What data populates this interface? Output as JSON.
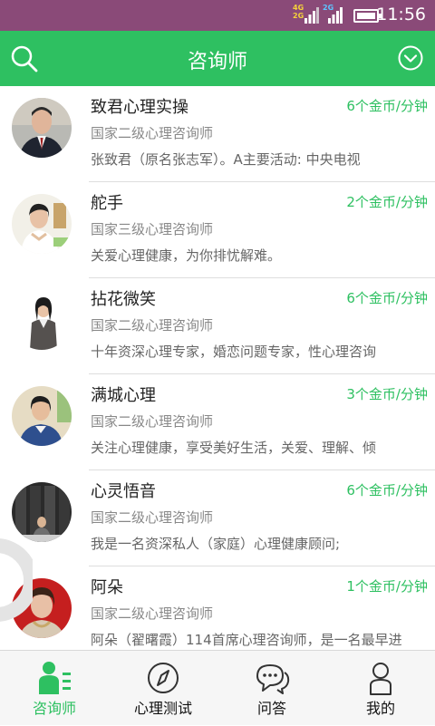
{
  "status_bar": {
    "network_a_top": "4G",
    "network_a_bottom": "2G",
    "network_b": "2G",
    "time": "11:56"
  },
  "app_bar": {
    "title": "咨询师",
    "search_icon": "search-icon",
    "dropdown_icon": "chevron-down-circle-icon"
  },
  "counselors": [
    {
      "name": "致君心理实操",
      "price": "6个金币/分钟",
      "level": "国家二级心理咨询师",
      "description": "张致君（原名张志军）。A主要活动: 中央电视"
    },
    {
      "name": "舵手",
      "price": "2个金币/分钟",
      "level": "国家三级心理咨询师",
      "description": "关爱心理健康，为你排忧解难。"
    },
    {
      "name": "拈花微笑",
      "price": "6个金币/分钟",
      "level": "国家二级心理咨询师",
      "description": "十年资深心理专家，婚恋问题专家，性心理咨询"
    },
    {
      "name": "满城心理",
      "price": "3个金币/分钟",
      "level": "国家二级心理咨询师",
      "description": "关注心理健康，享受美好生活，关爱、理解、倾"
    },
    {
      "name": "心灵悟音",
      "price": "6个金币/分钟",
      "level": "国家二级心理咨询师",
      "description": "我是一名资深私人（家庭）心理健康顾问;"
    },
    {
      "name": "阿朵",
      "price": "1个金币/分钟",
      "level": "国家二级心理咨询师",
      "description": "阿朵（翟曙霞）114首席心理咨询师，是一名最早进"
    }
  ],
  "tab_bar": {
    "tabs": [
      {
        "label": "咨询师",
        "icon": "counselor-icon",
        "active": true
      },
      {
        "label": "心理测试",
        "icon": "compass-icon",
        "active": false
      },
      {
        "label": "问答",
        "icon": "chat-bubbles-icon",
        "active": false
      },
      {
        "label": "我的",
        "icon": "person-icon",
        "active": false
      }
    ]
  },
  "colors": {
    "accent": "#2ec061",
    "status_bar": "#8a4a78"
  }
}
